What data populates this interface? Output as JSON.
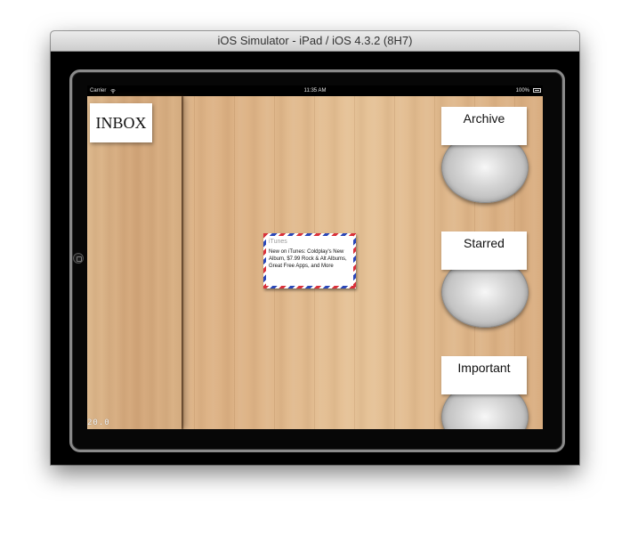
{
  "window": {
    "title": "iOS Simulator - iPad / iOS 4.3.2 (8H7)"
  },
  "statusbar": {
    "carrier": "Carrier",
    "time": "11:35 AM",
    "battery": "100%"
  },
  "sidebar": {
    "inbox_label": "INBOX",
    "version": "20.0"
  },
  "email": {
    "sender": "iTunes",
    "subject": "New on iTunes: Coldplay's New Album, $7.99 Rock & Alt Albums, Great Free Apps, and More"
  },
  "bins": [
    {
      "label": "Archive"
    },
    {
      "label": "Starred"
    },
    {
      "label": "Important"
    }
  ],
  "colors": {
    "wood": "#dfb88b",
    "airmail_red": "#d9303a",
    "airmail_blue": "#2a47b8"
  }
}
